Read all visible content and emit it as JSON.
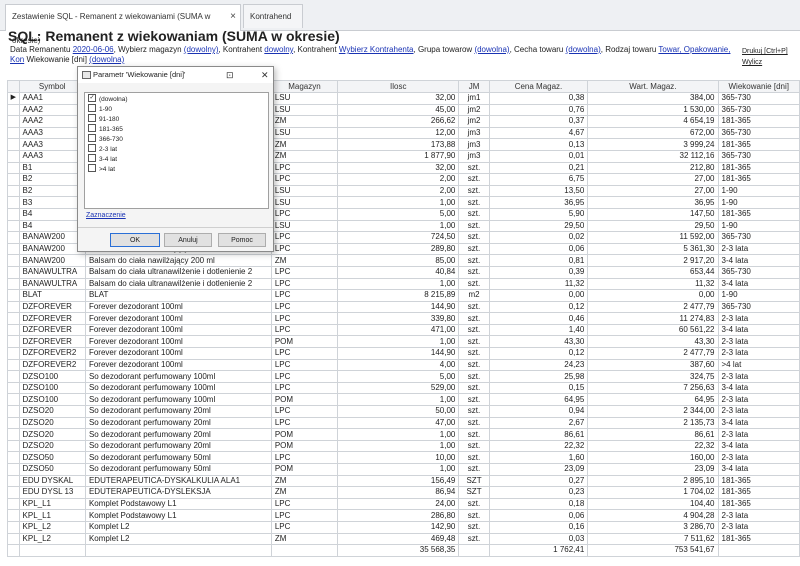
{
  "tabs": [
    {
      "label": "Zestawienie SQL - Remanent z wiekowaniami (SUMA w okresie)",
      "close": "×"
    },
    {
      "label": "Kontrahend",
      "close": ""
    }
  ],
  "report": {
    "title": "SQL: Remanent z wiekowaniam (SUMA w okresie)",
    "params": [
      {
        "text": "Data Remanentu ",
        "link": false
      },
      {
        "text": "2020-06-06",
        "link": true
      },
      {
        "text": ", Wybierz magazyn ",
        "link": false
      },
      {
        "text": "(dowolny)",
        "link": true
      },
      {
        "text": ", Kontrahent ",
        "link": false
      },
      {
        "text": "dowolny",
        "link": true
      },
      {
        "text": ", Kontrahent ",
        "link": false
      },
      {
        "text": "Wybierz Kontrahenta",
        "link": true
      },
      {
        "text": ", Grupa towarow ",
        "link": false
      },
      {
        "text": "(dowolna)",
        "link": true
      },
      {
        "text": ", Cecha towaru ",
        "link": false
      },
      {
        "text": "(dowolna)",
        "link": true
      },
      {
        "text": ", Rodzaj towaru ",
        "link": false
      },
      {
        "text": "Towar, Opakowanie, Kon",
        "link": true
      },
      {
        "text": " Wiekowanie [dni] ",
        "link": false
      },
      {
        "text": "(dowolna)",
        "link": true
      }
    ],
    "print_link": "Drukuj [Ctrl+P]",
    "compute_link": "Wylicz"
  },
  "table": {
    "columns": [
      "",
      "Symbol",
      "Nazwa",
      "Magazyn",
      "Ilosc",
      "JM",
      "Cena Magaz.",
      "Wart. Magaz.",
      "Wiekowanie [dni]"
    ],
    "rows": [
      [
        "▶",
        "AAA1",
        "",
        "LSU",
        "32,00",
        "jm1",
        "0,38",
        "384,00",
        "365-730"
      ],
      [
        "",
        "AAA2",
        "",
        "LSU",
        "45,00",
        "jm2",
        "0,76",
        "1 530,00",
        "365-730"
      ],
      [
        "",
        "AAA2",
        "",
        "ZM",
        "266,62",
        "jm2",
        "0,37",
        "4 654,19",
        "181-365"
      ],
      [
        "",
        "AAA3",
        "",
        "LSU",
        "12,00",
        "jm3",
        "4,67",
        "672,00",
        "365-730"
      ],
      [
        "",
        "AAA3",
        "",
        "ZM",
        "173,88",
        "jm3",
        "0,13",
        "3 999,24",
        "181-365"
      ],
      [
        "",
        "AAA3",
        "",
        "ZM",
        "1 877,90",
        "jm3",
        "0,01",
        "32 112,16",
        "365-730"
      ],
      [
        "",
        "B1",
        "",
        "LPC",
        "32,00",
        "szt.",
        "0,21",
        "212,80",
        "181-365"
      ],
      [
        "",
        "B2",
        "",
        "LPC",
        "2,00",
        "szt.",
        "6,75",
        "27,00",
        "181-365"
      ],
      [
        "",
        "B2",
        "",
        "LSU",
        "2,00",
        "szt.",
        "13,50",
        "27,00",
        "1-90"
      ],
      [
        "",
        "B3",
        "",
        "LSU",
        "1,00",
        "szt.",
        "36,95",
        "36,95",
        "1-90"
      ],
      [
        "",
        "B4",
        "",
        "LPC",
        "5,00",
        "szt.",
        "5,90",
        "147,50",
        "181-365"
      ],
      [
        "",
        "B4",
        "",
        "LSU",
        "1,00",
        "szt.",
        "29,50",
        "29,50",
        "1-90"
      ],
      [
        "",
        "BANAW200",
        "",
        "LPC",
        "724,50",
        "szt.",
        "0,02",
        "11 592,00",
        "365-730"
      ],
      [
        "",
        "BANAW200",
        "Balsam do ciała nawilżający 200 ml",
        "LPC",
        "289,80",
        "szt.",
        "0,06",
        "5 361,30",
        "2-3 lata"
      ],
      [
        "",
        "BANAW200",
        "Balsam do ciała nawilżający 200 ml",
        "ZM",
        "85,00",
        "szt.",
        "0,81",
        "2 917,20",
        "3-4 lata"
      ],
      [
        "",
        "BANAWULTRA",
        "Balsam do ciała ultranawilżenie i dotlenienie 2",
        "LPC",
        "40,84",
        "szt.",
        "0,39",
        "653,44",
        "365-730"
      ],
      [
        "",
        "BANAWULTRA",
        "Balsam do ciała ultranawilżenie i dotlenienie 2",
        "LPC",
        "1,00",
        "szt.",
        "11,32",
        "11,32",
        "3-4 lata"
      ],
      [
        "",
        "BLAT",
        "BLAT",
        "LPC",
        "8 215,89",
        "m2",
        "0,00",
        "0,00",
        "1-90"
      ],
      [
        "",
        "DZFOREVER",
        "Forever dezodorant 100ml",
        "LPC",
        "144,90",
        "szt.",
        "0,12",
        "2 477,79",
        "365-730"
      ],
      [
        "",
        "DZFOREVER",
        "Forever dezodorant 100ml",
        "LPC",
        "339,80",
        "szt.",
        "0,46",
        "11 274,83",
        "2-3 lata"
      ],
      [
        "",
        "DZFOREVER",
        "Forever dezodorant 100ml",
        "LPC",
        "471,00",
        "szt.",
        "1,40",
        "60 561,22",
        "3-4 lata"
      ],
      [
        "",
        "DZFOREVER",
        "Forever dezodorant 100ml",
        "POM",
        "1,00",
        "szt.",
        "43,30",
        "43,30",
        "2-3 lata"
      ],
      [
        "",
        "DZFOREVER2",
        "Forever dezodorant 100ml",
        "LPC",
        "144,90",
        "szt.",
        "0,12",
        "2 477,79",
        "2-3 lata"
      ],
      [
        "",
        "DZFOREVER2",
        "Forever dezodorant 100ml",
        "LPC",
        "4,00",
        "szt.",
        "24,23",
        "387,60",
        ">4 lat"
      ],
      [
        "",
        "DZSO100",
        "So dezodorant perfumowany 100ml",
        "LPC",
        "5,00",
        "szt.",
        "25,98",
        "324,75",
        "2-3 lata"
      ],
      [
        "",
        "DZSO100",
        "So dezodorant perfumowany 100ml",
        "LPC",
        "529,00",
        "szt.",
        "0,15",
        "7 256,63",
        "3-4 lata"
      ],
      [
        "",
        "DZSO100",
        "So dezodorant perfumowany 100ml",
        "POM",
        "1,00",
        "szt.",
        "64,95",
        "64,95",
        "2-3 lata"
      ],
      [
        "",
        "DZSO20",
        "So dezodorant perfumowany 20ml",
        "LPC",
        "50,00",
        "szt.",
        "0,94",
        "2 344,00",
        "2-3 lata"
      ],
      [
        "",
        "DZSO20",
        "So dezodorant perfumowany 20ml",
        "LPC",
        "47,00",
        "szt.",
        "2,67",
        "2 135,73",
        "3-4 lata"
      ],
      [
        "",
        "DZSO20",
        "So dezodorant perfumowany 20ml",
        "POM",
        "1,00",
        "szt.",
        "86,61",
        "86,61",
        "2-3 lata"
      ],
      [
        "",
        "DZSO20",
        "So dezodorant perfumowany 20ml",
        "POM",
        "1,00",
        "szt.",
        "22,32",
        "22,32",
        "3-4 lata"
      ],
      [
        "",
        "DZSO50",
        "So dezodorant perfumowany 50ml",
        "LPC",
        "10,00",
        "szt.",
        "1,60",
        "160,00",
        "2-3 lata"
      ],
      [
        "",
        "DZSO50",
        "So dezodorant perfumowany 50ml",
        "POM",
        "1,00",
        "szt.",
        "23,09",
        "23,09",
        "3-4 lata"
      ],
      [
        "",
        "EDU DYSKAL",
        "EDUTERAPEUTICA-DYSKALKULIA ALA1",
        "ZM",
        "156,49",
        "SZT",
        "0,27",
        "2 895,10",
        "181-365"
      ],
      [
        "",
        "EDU DYSL 13",
        "EDUTERAPEUTICA-DYSLEKSJA",
        "ZM",
        "86,94",
        "SZT",
        "0,23",
        "1 704,02",
        "181-365"
      ],
      [
        "",
        "KPL_L1",
        "Komplet Podstawowy L1",
        "LPC",
        "24,00",
        "szt.",
        "0,18",
        "104,40",
        "181-365"
      ],
      [
        "",
        "KPL_L1",
        "Komplet Podstawowy L1",
        "LPC",
        "286,80",
        "szt.",
        "0,06",
        "4 904,28",
        "2-3 lata"
      ],
      [
        "",
        "KPL_L2",
        "Komplet L2",
        "LPC",
        "142,90",
        "szt.",
        "0,16",
        "3 286,70",
        "2-3 lata"
      ],
      [
        "",
        "KPL_L2",
        "Komplet L2",
        "ZM",
        "469,48",
        "szt.",
        "0,03",
        "7 511,62",
        "181-365"
      ]
    ],
    "footer": [
      "",
      "",
      "",
      "",
      "35 568,35",
      "",
      "1 762,41",
      "753 541,67",
      ""
    ]
  },
  "dialog": {
    "title": "Parametr 'Wiekowanie [dni]'",
    "restore_glyph": "⊡",
    "close_glyph": "✕",
    "options": [
      {
        "label": "(dowolna)",
        "checked": true
      },
      {
        "label": "1-90",
        "checked": false
      },
      {
        "label": "91-180",
        "checked": false
      },
      {
        "label": "181-365",
        "checked": false
      },
      {
        "label": "366-730",
        "checked": false
      },
      {
        "label": "2-3 lat",
        "checked": false
      },
      {
        "label": "3-4 lat",
        "checked": false
      },
      {
        "label": ">4 lat",
        "checked": false
      }
    ],
    "select_link": "Zaznaczenie",
    "ok": "OK",
    "cancel": "Anuluj",
    "help": "Pomoc"
  }
}
